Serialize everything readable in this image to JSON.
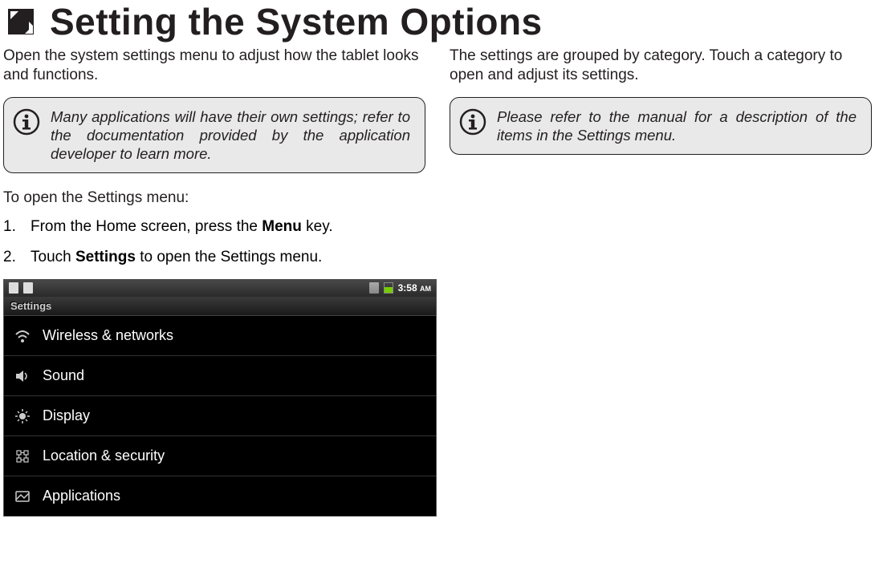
{
  "title": "Setting the System Options",
  "left": {
    "intro": "Open the system settings menu to adjust how the tablet looks and functions.",
    "info": "Many applications will have their own settings; refer to the documentation provided by the application developer to learn more.",
    "open_heading": "To open the Settings menu:",
    "steps": [
      {
        "num": "1.",
        "pre": "From the Home screen, press the ",
        "bold": "Menu",
        "post": " key."
      },
      {
        "num": "2.",
        "pre": "Touch ",
        "bold": "Settings",
        "post": " to open the Settings menu."
      }
    ]
  },
  "right": {
    "intro": "The settings are grouped by category. Touch a category to open and adjust its settings.",
    "info": "Please refer to the manual for a description of the items in the Settings menu."
  },
  "screenshot": {
    "time": "3:58",
    "ampm": "AM",
    "header": "Settings",
    "items": [
      {
        "icon": "wifi-icon",
        "label": "Wireless & networks"
      },
      {
        "icon": "speaker-icon",
        "label": "Sound"
      },
      {
        "icon": "brightness-icon",
        "label": "Display"
      },
      {
        "icon": "location-icon",
        "label": "Location & security"
      },
      {
        "icon": "apps-icon",
        "label": "Applications"
      }
    ]
  }
}
